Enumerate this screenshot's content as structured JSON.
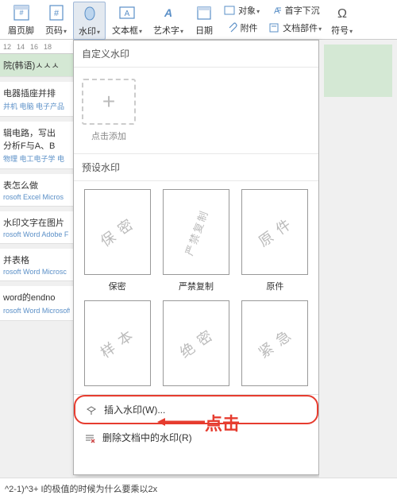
{
  "ribbon": {
    "header_footer": "眉页脚",
    "page_number": "页码",
    "watermark": "水印",
    "text_box": "文本框",
    "word_art": "艺术字",
    "date": "日期",
    "object": "对象",
    "attachment": "附件",
    "drop_cap": "首字下沉",
    "doc_parts": "文档部件",
    "symbol": "符号"
  },
  "ruler": [
    "12",
    "14",
    "16",
    "18"
  ],
  "content": {
    "rows": [
      {
        "title": "院(韩语)ㅅㅅㅅ",
        "sub": ""
      },
      {
        "title": "电器插座并排",
        "sub": "并机 电脑 电子产品"
      },
      {
        "title": "辑电路，写出",
        "sub": "分析F与A、B",
        "sub2": "物理 电工电子学 电"
      },
      {
        "title": "表怎么做",
        "sub": "rosoft Excel Micros"
      },
      {
        "title": "水印文字在图片",
        "sub": "rosoft Word Adobe F"
      },
      {
        "title": "并表格",
        "sub": "rosoft Word Microsc"
      },
      {
        "title": "word的endno",
        "sub": "rosoft Word Microsoft Office 办公软件 WPS Office"
      }
    ]
  },
  "dropdown": {
    "custom_header": "自定义水印",
    "add_label": "点击添加",
    "preset_header": "预设水印",
    "presets": [
      {
        "wm": "保 密",
        "caption": "保密"
      },
      {
        "wm": "严禁复制",
        "caption": "严禁复制",
        "vertical": true
      },
      {
        "wm": "原 件",
        "caption": "原件"
      },
      {
        "wm": "样 本",
        "caption": ""
      },
      {
        "wm": "绝 密",
        "caption": ""
      },
      {
        "wm": "紧 急",
        "caption": ""
      }
    ],
    "insert_watermark": "插入水印(W)...",
    "remove_watermark": "删除文档中的水印(R)"
  },
  "annotation": {
    "text": "点击"
  },
  "footer": "^2-1)^3+ I的极值的时候为什么要乘以2x"
}
